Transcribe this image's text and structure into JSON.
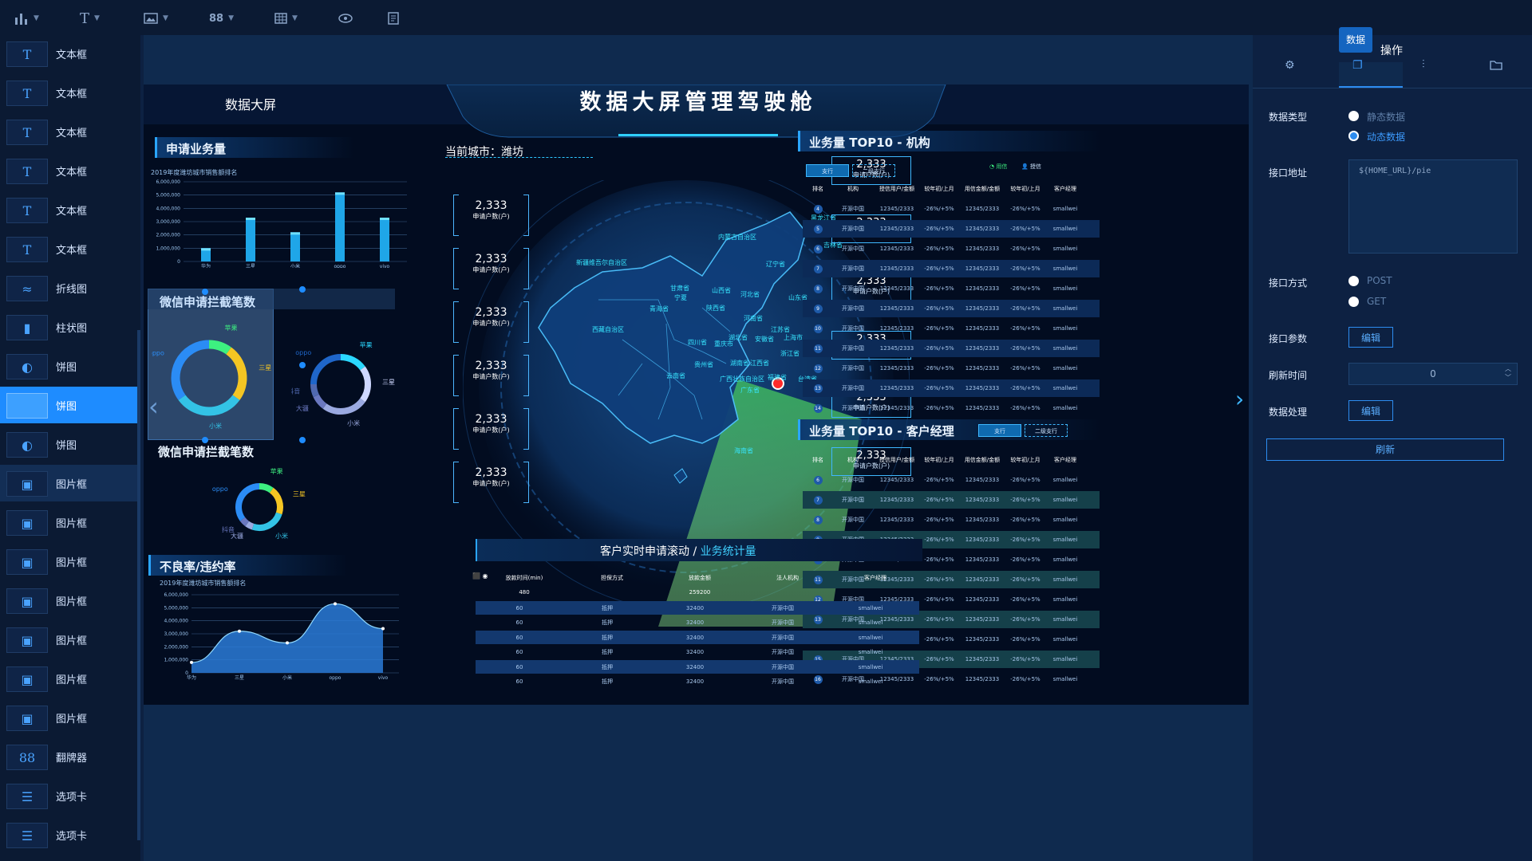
{
  "toolbar": {
    "items": [
      {
        "name": "chart-menu",
        "icon": "bar-chart-icon"
      },
      {
        "name": "text-menu",
        "icon": "text-icon",
        "glyph": "T"
      },
      {
        "name": "image-menu",
        "icon": "image-icon"
      },
      {
        "name": "flip-menu",
        "icon": "flip-card-icon",
        "glyph": "88"
      },
      {
        "name": "table-menu",
        "icon": "table-icon"
      },
      {
        "name": "preview",
        "icon": "eye-icon"
      },
      {
        "name": "notes",
        "icon": "document-icon"
      }
    ]
  },
  "sidebar": {
    "items": [
      {
        "label": "文本框",
        "icon": "text-icon",
        "glyph": "T"
      },
      {
        "label": "文本框",
        "icon": "text-icon",
        "glyph": "T"
      },
      {
        "label": "文本框",
        "icon": "text-icon",
        "glyph": "T"
      },
      {
        "label": "文本框",
        "icon": "text-icon",
        "glyph": "T"
      },
      {
        "label": "文本框",
        "icon": "text-icon",
        "glyph": "T"
      },
      {
        "label": "文本框",
        "icon": "text-icon",
        "glyph": "T"
      },
      {
        "label": "折线图",
        "icon": "line-chart-icon",
        "glyph": "≈"
      },
      {
        "label": "柱状图",
        "icon": "bar-chart-icon",
        "glyph": "▮"
      },
      {
        "label": "饼图",
        "icon": "pie-chart-icon",
        "glyph": "◐"
      },
      {
        "label": "饼图",
        "icon": "pie-chart-icon",
        "glyph": ""
      },
      {
        "label": "饼图",
        "icon": "pie-chart-icon",
        "glyph": "◐"
      },
      {
        "label": "图片框",
        "icon": "image-icon",
        "glyph": "▣"
      },
      {
        "label": "图片框",
        "icon": "image-icon",
        "glyph": "▣"
      },
      {
        "label": "图片框",
        "icon": "image-icon",
        "glyph": "▣"
      },
      {
        "label": "图片框",
        "icon": "image-icon",
        "glyph": "▣"
      },
      {
        "label": "图片框",
        "icon": "image-icon",
        "glyph": "▣"
      },
      {
        "label": "图片框",
        "icon": "image-icon",
        "glyph": "▣"
      },
      {
        "label": "图片框",
        "icon": "image-icon",
        "glyph": "▣"
      },
      {
        "label": "翻牌器",
        "icon": "flip-card-icon",
        "glyph": "88"
      },
      {
        "label": "选项卡",
        "icon": "tabs-icon",
        "glyph": "☰"
      },
      {
        "label": "选项卡",
        "icon": "tabs-icon",
        "glyph": "☰"
      }
    ]
  },
  "board": {
    "header_left": "数据大屏",
    "main_title": "数据大屏管理驾驶舱",
    "apply_panel": {
      "title": "申请业务量",
      "subtitle": "2019年度潍坊城市销售额排名"
    },
    "wechat_selected": {
      "title": "微信申请拦截笔数"
    },
    "wechat2": {
      "title": "微信申请拦截笔数"
    },
    "bad_rate": {
      "title": "不良率/违约率",
      "subtitle": "2019年度潍坊城市销售额排名"
    },
    "city": {
      "label": "当前城市：",
      "value": "潍坊"
    },
    "stats": {
      "value": "2,333",
      "caption": "申请户数(户)"
    },
    "top10_org": {
      "title": "业务量 TOP10 - 机构",
      "tab1": "支行",
      "tab2": "二级支行",
      "legend1": "用信",
      "legend2": "授信"
    },
    "top10_mgr": {
      "title": "业务量 TOP10 - 客户经理",
      "tab1": "支行",
      "tab2": "二级支行"
    },
    "table_headers": [
      "排名",
      "机构",
      "授信用户/金额",
      "较年初/上月",
      "用信金额/金额",
      "较年初/上月",
      "客户经理"
    ],
    "row_cells": {
      "org": "开源中国",
      "amount": "12345/2333",
      "change": "-26%/+5%",
      "manager": "smallwei"
    },
    "org_ranks": [
      "4",
      "5",
      "6",
      "7",
      "8",
      "9",
      "10",
      "11",
      "12",
      "13",
      "14"
    ],
    "mgr_ranks": [
      "6",
      "7",
      "8",
      "9",
      "10",
      "11",
      "12",
      "13",
      "14",
      "15",
      "16"
    ],
    "scroll": {
      "title": "客户实时申请滚动 /",
      "title_accent": "业务统计量",
      "headers": [
        "放款时间(min)",
        "担保方式",
        "放款金额",
        "法人机构",
        "客户经理"
      ],
      "summary": [
        "480",
        "",
        "259200",
        "",
        ""
      ],
      "row": [
        "60",
        "抵押",
        "32400",
        "开源中国",
        "smallwei"
      ]
    },
    "map_labels": [
      "黑龙江省",
      "吉林省",
      "内蒙古自治区",
      "辽宁省",
      "新疆维吾尔自治区",
      "甘肃省",
      "宁夏",
      "山西省",
      "河北省",
      "山东省",
      "青海省",
      "陕西省",
      "河南省",
      "江苏省",
      "西藏自治区",
      "四川省",
      "湖北省",
      "安徽省",
      "上海市",
      "重庆市",
      "浙江省",
      "贵州省",
      "湖南省",
      "江西省",
      "云南省",
      "广西壮族自治区",
      "福建省",
      "台湾省",
      "广东省",
      "海南省"
    ]
  },
  "chart_data": [
    {
      "type": "bar",
      "title": "2019年度潍坊城市销售额排名",
      "categories": [
        "华为",
        "三星",
        "小米",
        "oppo",
        "vivo"
      ],
      "values": [
        1000000,
        3300000,
        2200000,
        5200000,
        3300000
      ],
      "ylim": [
        0,
        6000000
      ],
      "yticks": [
        "0",
        "1,000,000",
        "2,000,000",
        "3,000,000",
        "4,000,000",
        "5,000,000",
        "6,000,000"
      ]
    },
    {
      "type": "pie",
      "title": "微信申请拦截笔数",
      "series": [
        {
          "name": "苹果",
          "value": 10
        },
        {
          "name": "三星",
          "value": 25
        },
        {
          "name": "小米",
          "value": 30
        },
        {
          "name": "oppo",
          "value": 35
        }
      ]
    },
    {
      "type": "pie",
      "series": [
        {
          "name": "苹果",
          "value": 15
        },
        {
          "name": "三星",
          "value": 20
        },
        {
          "name": "小米",
          "value": 25
        },
        {
          "name": "大疆",
          "value": 8
        },
        {
          "name": "抖音",
          "value": 7
        },
        {
          "name": "oppo",
          "value": 25
        }
      ]
    },
    {
      "type": "pie",
      "title": "微信申请拦截笔数",
      "series": [
        {
          "name": "苹果",
          "value": 10
        },
        {
          "name": "三星",
          "value": 20
        },
        {
          "name": "小米",
          "value": 25
        },
        {
          "name": "大疆",
          "value": 5
        },
        {
          "name": "抖音",
          "value": 5
        },
        {
          "name": "oppo",
          "value": 35
        }
      ]
    },
    {
      "type": "area",
      "title": "2019年度潍坊城市销售额排名",
      "x": [
        "华为",
        "三星",
        "小米",
        "oppo",
        "vivo"
      ],
      "values": [
        800000,
        3200000,
        2300000,
        5300000,
        3400000
      ],
      "ylim": [
        0,
        6000000
      ],
      "yticks": [
        "0",
        "1,000,000",
        "2,000,000",
        "3,000,000",
        "4,000,000",
        "5,000,000",
        "6,000,000"
      ]
    }
  ],
  "right_panel": {
    "tab_data": "数据",
    "tab_operate": "操作",
    "icons": [
      "gear-icon",
      "copy-icon",
      "sliders-icon",
      "folder-icon"
    ],
    "data_type": {
      "label": "数据类型",
      "options": [
        "静态数据",
        "动态数据"
      ],
      "selected": "动态数据"
    },
    "api_url": {
      "label": "接口地址",
      "value": "${HOME_URL}/pie"
    },
    "api_method": {
      "label": "接口方式",
      "options": [
        "POST",
        "GET"
      ]
    },
    "api_params": {
      "label": "接口参数",
      "button": "编辑"
    },
    "refresh_time": {
      "label": "刷新时间",
      "value": "0"
    },
    "data_process": {
      "label": "数据处理",
      "button": "编辑"
    },
    "refresh_button": "刷新",
    "colors": {
      "accent": "#2d8cf0",
      "highlight": "#1e8cff"
    }
  }
}
